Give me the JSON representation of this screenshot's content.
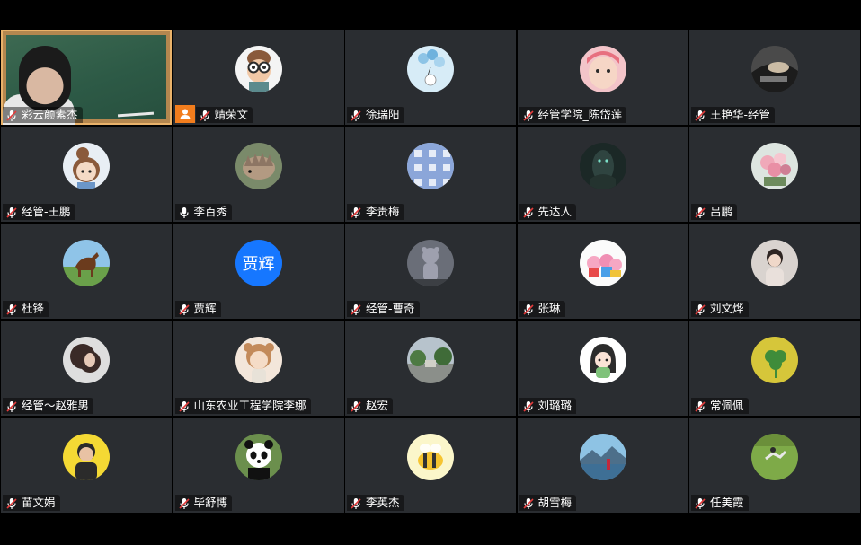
{
  "participants": [
    {
      "name": "彩云颜素杰",
      "type": "video",
      "mic": "muted",
      "active": true
    },
    {
      "name": "靖荣文",
      "type": "avatar",
      "avatar": "cartoon-glasses",
      "mic": "muted",
      "host": true
    },
    {
      "name": "徐瑞阳",
      "type": "avatar",
      "avatar": "balloon-bear",
      "mic": "muted"
    },
    {
      "name": "经管学院_陈岱莲",
      "type": "avatar",
      "avatar": "baby-photo",
      "mic": "muted"
    },
    {
      "name": "王艳华-经管",
      "type": "avatar",
      "avatar": "car-interior",
      "mic": "muted"
    },
    {
      "name": "经管-王鹏",
      "type": "avatar",
      "avatar": "cartoon-girl",
      "mic": "muted"
    },
    {
      "name": "李百秀",
      "type": "avatar",
      "avatar": "hedgehog",
      "mic": "on"
    },
    {
      "name": "李贵梅",
      "type": "avatar",
      "avatar": "blue-gingham",
      "mic": "muted"
    },
    {
      "name": "先达人",
      "type": "avatar",
      "avatar": "dark-warrior",
      "mic": "muted"
    },
    {
      "name": "吕鹏",
      "type": "avatar",
      "avatar": "flowers",
      "mic": "muted"
    },
    {
      "name": "杜锋",
      "type": "avatar",
      "avatar": "horse",
      "mic": "muted"
    },
    {
      "name": "贾辉",
      "type": "text-avatar",
      "initials": "贾辉",
      "mic": "muted"
    },
    {
      "name": "经管-曹奇",
      "type": "avatar",
      "avatar": "bear-statue",
      "mic": "muted"
    },
    {
      "name": "张琳",
      "type": "avatar",
      "avatar": "peppa-pig",
      "mic": "muted"
    },
    {
      "name": "刘文烨",
      "type": "avatar",
      "avatar": "child-photo",
      "mic": "muted"
    },
    {
      "name": "经管～赵雅男",
      "type": "avatar",
      "avatar": "woman-curly-hair",
      "mic": "muted"
    },
    {
      "name": "山东农业工程学院李娜",
      "type": "avatar",
      "avatar": "baby-bear-costume",
      "mic": "muted"
    },
    {
      "name": "赵宏",
      "type": "avatar",
      "avatar": "plaza-trees",
      "mic": "muted"
    },
    {
      "name": "刘璐璐",
      "type": "avatar",
      "avatar": "cartoon-girl-pink",
      "mic": "muted"
    },
    {
      "name": "常佩佩",
      "type": "avatar",
      "avatar": "clover",
      "mic": "muted"
    },
    {
      "name": "苗文娟",
      "type": "avatar",
      "avatar": "boy-yellow",
      "mic": "muted"
    },
    {
      "name": "毕舒博",
      "type": "avatar",
      "avatar": "panda",
      "mic": "muted"
    },
    {
      "name": "李英杰",
      "type": "avatar",
      "avatar": "cartoon-bee",
      "mic": "muted"
    },
    {
      "name": "胡雪梅",
      "type": "avatar",
      "avatar": "lake-mountains",
      "mic": "muted"
    },
    {
      "name": "任美霞",
      "type": "avatar",
      "avatar": "person-on-grass",
      "mic": "muted"
    }
  ],
  "colors": {
    "tile_bg": "#2a2d31",
    "active_border": "#e9b26a",
    "host_badge": "#f27d1d",
    "text_avatar": "#1677ff",
    "mute_red": "#e23b3b"
  }
}
